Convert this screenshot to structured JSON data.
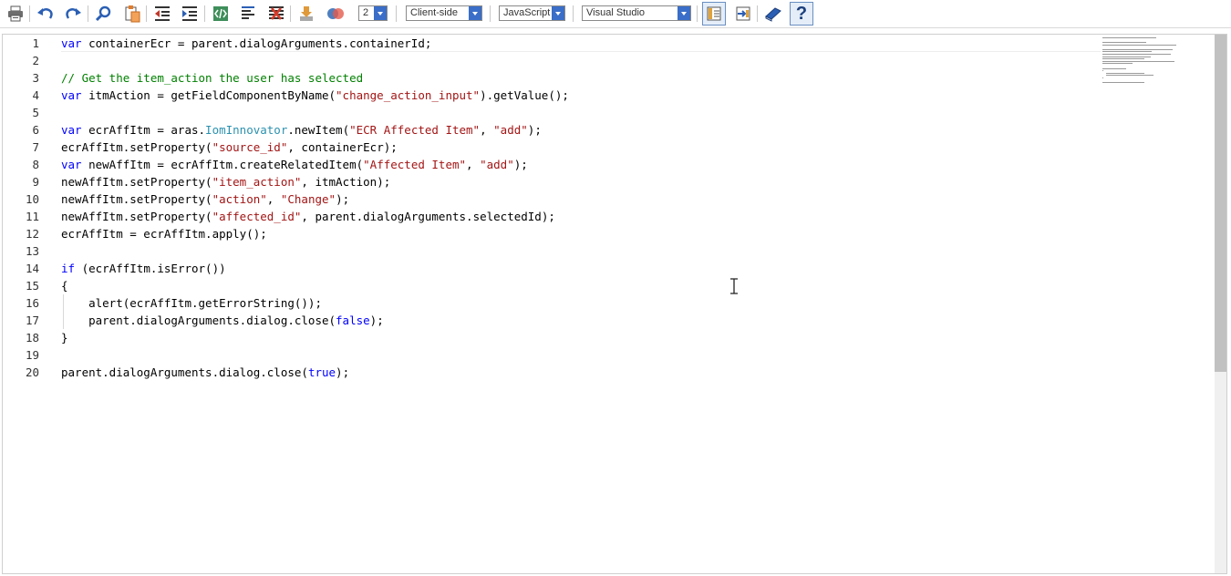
{
  "toolbar": {
    "tools": [
      {
        "name": "print-icon"
      },
      {
        "name": "undo-icon"
      },
      {
        "name": "redo-icon"
      },
      {
        "name": "find-icon"
      },
      {
        "name": "paste-icon"
      },
      {
        "name": "outdent-icon"
      },
      {
        "name": "indent-icon"
      },
      {
        "name": "xml-tag-icon"
      },
      {
        "name": "format-lines-icon"
      },
      {
        "name": "clear-format-icon"
      },
      {
        "name": "download-icon"
      },
      {
        "name": "link-circles-icon"
      }
    ],
    "page_select": {
      "value": "2"
    },
    "location_select": {
      "value": "Client-side"
    },
    "language_select": {
      "value": "JavaScript"
    },
    "theme_select": {
      "value": "Visual Studio"
    },
    "right_tools": [
      {
        "name": "panel-toggle-icon",
        "toggled": true
      },
      {
        "name": "export-icon",
        "toggled": false
      },
      {
        "name": "book-icon",
        "toggled": false
      },
      {
        "name": "help-icon",
        "label": "?"
      }
    ]
  },
  "editor": {
    "current_line": 1,
    "lines": [
      {
        "n": "1",
        "tokens": [
          {
            "t": "kw",
            "v": "var"
          },
          {
            "t": "",
            "v": " containerEcr = parent.dialogArguments.containerId;"
          }
        ]
      },
      {
        "n": "2",
        "tokens": []
      },
      {
        "n": "3",
        "tokens": [
          {
            "t": "cm",
            "v": "// Get the item_action the user has selected"
          }
        ]
      },
      {
        "n": "4",
        "tokens": [
          {
            "t": "kw",
            "v": "var"
          },
          {
            "t": "",
            "v": " itmAction = getFieldComponentByName("
          },
          {
            "t": "str",
            "v": "\"change_action_input\""
          },
          {
            "t": "",
            "v": ").getValue();"
          }
        ]
      },
      {
        "n": "5",
        "tokens": []
      },
      {
        "n": "6",
        "tokens": [
          {
            "t": "kw",
            "v": "var"
          },
          {
            "t": "",
            "v": " ecrAffItm = aras."
          },
          {
            "t": "cls",
            "v": "IomInnovator"
          },
          {
            "t": "",
            "v": ".newItem("
          },
          {
            "t": "str",
            "v": "\"ECR Affected Item\""
          },
          {
            "t": "",
            "v": ", "
          },
          {
            "t": "str",
            "v": "\"add\""
          },
          {
            "t": "",
            "v": ");"
          }
        ]
      },
      {
        "n": "7",
        "tokens": [
          {
            "t": "",
            "v": "ecrAffItm.setProperty("
          },
          {
            "t": "str",
            "v": "\"source_id\""
          },
          {
            "t": "",
            "v": ", containerEcr);"
          }
        ]
      },
      {
        "n": "8",
        "tokens": [
          {
            "t": "kw",
            "v": "var"
          },
          {
            "t": "",
            "v": " newAffItm = ecrAffItm.createRelatedItem("
          },
          {
            "t": "str",
            "v": "\"Affected Item\""
          },
          {
            "t": "",
            "v": ", "
          },
          {
            "t": "str",
            "v": "\"add\""
          },
          {
            "t": "",
            "v": ");"
          }
        ]
      },
      {
        "n": "9",
        "tokens": [
          {
            "t": "",
            "v": "newAffItm.setProperty("
          },
          {
            "t": "str",
            "v": "\"item_action\""
          },
          {
            "t": "",
            "v": ", itmAction);"
          }
        ]
      },
      {
        "n": "10",
        "tokens": [
          {
            "t": "",
            "v": "newAffItm.setProperty("
          },
          {
            "t": "str",
            "v": "\"action\""
          },
          {
            "t": "",
            "v": ", "
          },
          {
            "t": "str",
            "v": "\"Change\""
          },
          {
            "t": "",
            "v": ");"
          }
        ]
      },
      {
        "n": "11",
        "tokens": [
          {
            "t": "",
            "v": "newAffItm.setProperty("
          },
          {
            "t": "str",
            "v": "\"affected_id\""
          },
          {
            "t": "",
            "v": ", parent.dialogArguments.selectedId);"
          }
        ]
      },
      {
        "n": "12",
        "tokens": [
          {
            "t": "",
            "v": "ecrAffItm = ecrAffItm.apply();"
          }
        ]
      },
      {
        "n": "13",
        "tokens": []
      },
      {
        "n": "14",
        "tokens": [
          {
            "t": "kw",
            "v": "if"
          },
          {
            "t": "",
            "v": " (ecrAffItm.isError())"
          }
        ]
      },
      {
        "n": "15",
        "tokens": [
          {
            "t": "",
            "v": "{"
          }
        ]
      },
      {
        "n": "16",
        "guide": true,
        "tokens": [
          {
            "t": "",
            "v": "    alert(ecrAffItm.getErrorString());"
          }
        ]
      },
      {
        "n": "17",
        "guide": true,
        "tokens": [
          {
            "t": "",
            "v": "    parent.dialogArguments.dialog.close("
          },
          {
            "t": "kw",
            "v": "false"
          },
          {
            "t": "",
            "v": ");"
          }
        ]
      },
      {
        "n": "18",
        "tokens": [
          {
            "t": "",
            "v": "}"
          }
        ]
      },
      {
        "n": "19",
        "tokens": []
      },
      {
        "n": "20",
        "tokens": [
          {
            "t": "",
            "v": "parent.dialogArguments.dialog.close("
          },
          {
            "t": "kw",
            "v": "true"
          },
          {
            "t": "",
            "v": ");"
          }
        ]
      }
    ]
  }
}
